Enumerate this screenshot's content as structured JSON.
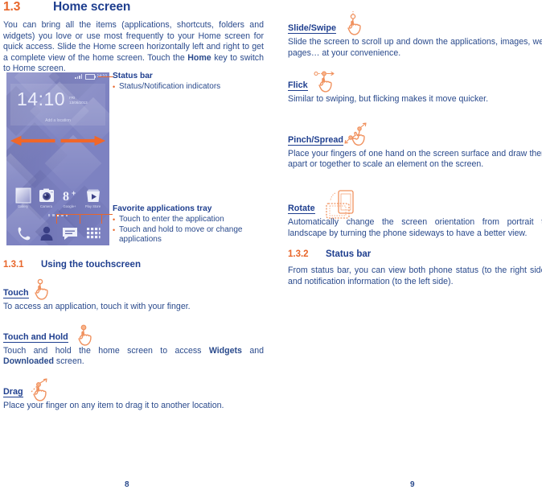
{
  "document": {
    "left_page_number": "8",
    "right_page_number": "9",
    "accent_orange": "#e8662a",
    "heading_blue": "#1f3f8f",
    "body_blue": "#2a4a8c"
  },
  "left_page": {
    "section": {
      "number": "1.3",
      "title": "Home screen"
    },
    "intro": "You can bring all the items (applications, shortcuts, folders and widgets) you love or use most frequently to your Home screen for quick access. Slide the Home screen horizontally left and right to get a complete view of the home screen. Touch the ",
    "intro_bold": "Home",
    "intro_tail": " key to switch to Home screen.",
    "phone": {
      "status_bar": {
        "time": "14:10",
        "signal_icon": "signal-bars-icon",
        "battery_icon": "battery-icon"
      },
      "clock_widget": {
        "time": "14:10",
        "day": "FRI",
        "date": "13/06/2013",
        "location_placeholder": "Add a location"
      },
      "swipe_arrows": {
        "left_icon": "arrow-left-icon",
        "right_icon": "arrow-right-icon"
      },
      "apps": [
        {
          "name": "Gallery",
          "icon": "gallery-icon"
        },
        {
          "name": "Camera",
          "icon": "camera-icon"
        },
        {
          "name": "Google+",
          "icon": "google-plus-icon"
        },
        {
          "name": "Play Store",
          "icon": "play-store-icon"
        }
      ],
      "page_dots": 5,
      "active_dot_index": 2,
      "dock": [
        {
          "name": "Phone",
          "icon": "phone-handset-icon"
        },
        {
          "name": "Contacts",
          "icon": "contact-person-icon"
        },
        {
          "name": "Messaging",
          "icon": "message-bubble-icon"
        },
        {
          "name": "All apps",
          "icon": "app-drawer-grid-icon"
        }
      ]
    },
    "callouts": {
      "status_bar": {
        "title": "Status bar",
        "bullets": [
          "Status/Notification indicators"
        ]
      },
      "favorites": {
        "title": "Favorite applications tray",
        "bullets": [
          "Touch to enter the application",
          "Touch and hold to move or change",
          "applications"
        ]
      }
    },
    "subsection": {
      "number": "1.3.1",
      "title": "Using the touchscreen"
    },
    "gestures": [
      {
        "label": "Touch",
        "icon": "hand-touch-icon",
        "description": "To access an application, touch it with your finger."
      },
      {
        "label": "Touch and Hold",
        "icon": "hand-touch-hold-icon",
        "description_pre": "Touch and hold the home screen to access ",
        "description_bold1": "Widgets",
        "description_mid": " and ",
        "description_bold2": "Downloaded",
        "description_post": " screen."
      },
      {
        "label": "Drag",
        "icon": "hand-drag-icon",
        "description": "Place your finger on any item to drag it to another location."
      }
    ]
  },
  "right_page": {
    "gestures": [
      {
        "label": "Slide/Swipe",
        "icon": "hand-slide-swipe-icon",
        "description": "Slide the screen to scroll up and down the applications, images, web pages… at your convenience."
      },
      {
        "label": "Flick",
        "icon": "hand-flick-icon",
        "description": "Similar to swiping, but flicking makes it move quicker."
      },
      {
        "label": "Pinch/Spread",
        "icon": "hand-pinch-spread-icon",
        "description": "Place your fingers of one hand on the screen surface and draw them apart or together to scale an element on the screen."
      },
      {
        "label": "Rotate",
        "icon": "screen-rotate-icon",
        "description": "Automatically change the screen orientation from portrait to landscape by turning the phone sideways to have a better view."
      }
    ],
    "subsection": {
      "number": "1.3.2",
      "title": "Status bar"
    },
    "status_bar_text": "From status bar, you can view both phone status (to the right side) and notification information (to the left side)."
  }
}
